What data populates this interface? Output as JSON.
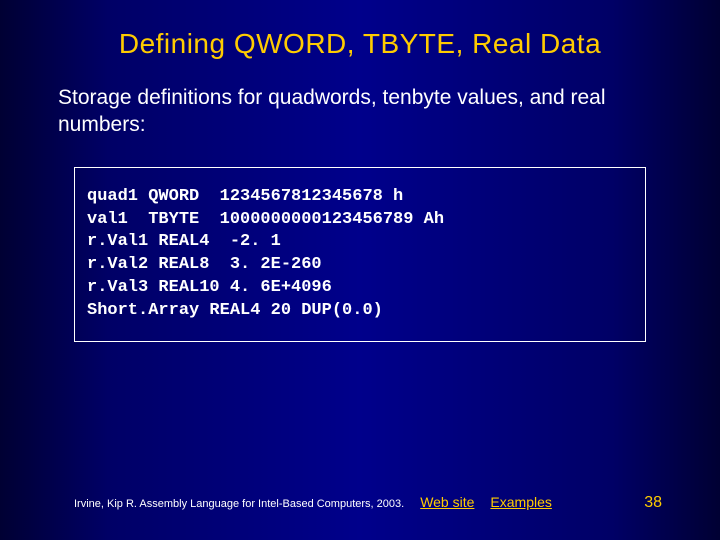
{
  "title": "Defining QWORD, TBYTE, Real Data",
  "body": "Storage definitions for quadwords, tenbyte values, and real numbers:",
  "code": {
    "l1": "quad1 QWORD  1234567812345678 h",
    "l2": "val1  TBYTE  1000000000123456789 Ah",
    "l3": "r.Val1 REAL4  -2. 1",
    "l4": "r.Val2 REAL8  3. 2E-260",
    "l5": "r.Val3 REAL10 4. 6E+4096",
    "l6": "Short.Array REAL4 20 DUP(0.0)"
  },
  "footer": {
    "citation": "Irvine, Kip R. Assembly Language for Intel-Based Computers, 2003.",
    "link_web": "Web site",
    "link_examples": "Examples",
    "page": "38"
  }
}
